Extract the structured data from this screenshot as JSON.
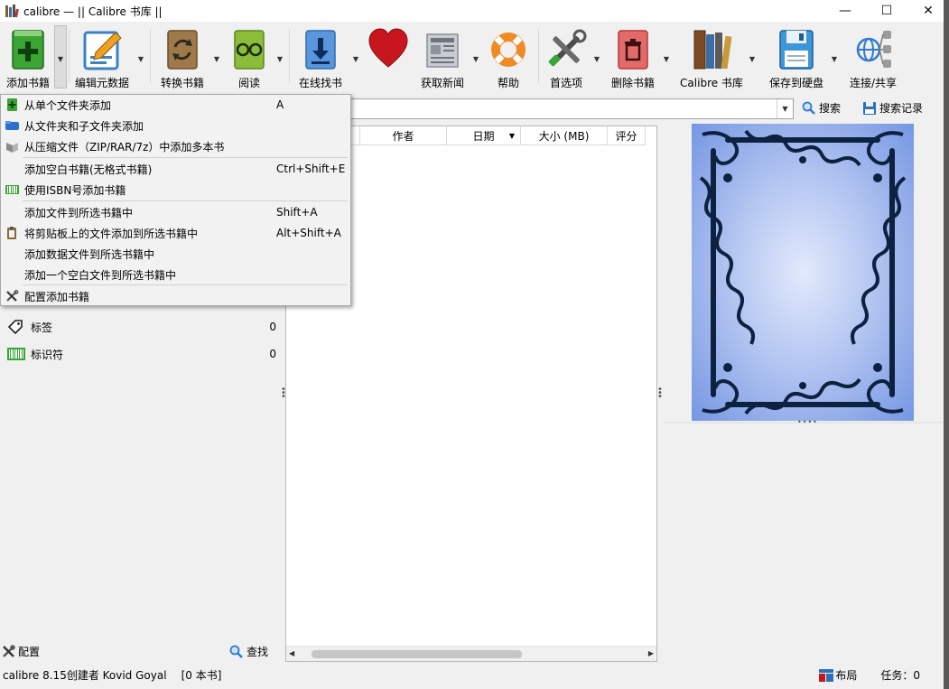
{
  "window": {
    "title": "calibre — || Calibre 书库 ||",
    "minimize_glyph": "—",
    "maximize_glyph": "☐",
    "close_glyph": "✕"
  },
  "toolbar": {
    "buttons": [
      {
        "label": "添加书籍",
        "icon": "add-book-icon"
      },
      {
        "label": "编辑元数据",
        "icon": "edit-metadata-icon"
      },
      {
        "label": "转换书籍",
        "icon": "convert-book-icon"
      },
      {
        "label": "阅读",
        "icon": "read-book-icon"
      },
      {
        "label": "在线找书",
        "icon": "find-books-online-icon"
      },
      {
        "label": "",
        "icon": "heart-icon"
      },
      {
        "label": "获取新闻",
        "icon": "news-icon"
      },
      {
        "label": "帮助",
        "icon": "help-lifebuoy-icon"
      },
      {
        "label": "首选项",
        "icon": "preferences-tools-icon"
      },
      {
        "label": "删除书籍",
        "icon": "remove-book-icon"
      },
      {
        "label": "Calibre 书库",
        "icon": "library-books-icon"
      },
      {
        "label": "保存到硬盘",
        "icon": "save-disk-icon"
      },
      {
        "label": "连接/共享",
        "icon": "connect-share-icon"
      }
    ]
  },
  "search": {
    "value": "",
    "search_label": "搜索",
    "history_label": "搜索记录"
  },
  "tag_browser": {
    "items": [
      {
        "label": "标签",
        "count": "0",
        "icon": "tag-icon"
      },
      {
        "label": "标识符",
        "count": "0",
        "icon": "barcode-icon"
      }
    ],
    "configure_label": "配置",
    "find_label": "查找"
  },
  "book_list": {
    "columns": [
      "作者",
      "日期",
      "大小 (MB)",
      "评分"
    ]
  },
  "add_menu": {
    "items": [
      {
        "label": "从单个文件夹添加",
        "shortcut": "A",
        "icon": "add-green-icon"
      },
      {
        "label": "从文件夹和子文件夹添加",
        "shortcut": "",
        "icon": "folder-blue-icon"
      },
      {
        "label": "从压缩文件（ZIP/RAR/7z）中添加多本书",
        "shortcut": "",
        "icon": "archive-book-icon"
      },
      {
        "label": "添加空白书籍(无格式书籍)",
        "shortcut": "Ctrl+Shift+E",
        "icon": ""
      },
      {
        "label": "使用ISBN号添加书籍",
        "shortcut": "",
        "icon": "barcode-icon"
      },
      {
        "label": "添加文件到所选书籍中",
        "shortcut": "Shift+A",
        "icon": ""
      },
      {
        "label": "将剪贴板上的文件添加到所选书籍中",
        "shortcut": "Alt+Shift+A",
        "icon": "clipboard-icon"
      },
      {
        "label": "添加数据文件到所选书籍中",
        "shortcut": "",
        "icon": ""
      },
      {
        "label": "添加一个空白文件到所选书籍中",
        "shortcut": "",
        "icon": ""
      },
      {
        "label": "配置添加书籍",
        "shortcut": "",
        "icon": "tools-icon"
      }
    ]
  },
  "status": {
    "left": "calibre 8.15创建者 Kovid Goyal",
    "book_count": "[0 本书]",
    "layout_label": "布局",
    "jobs": "任务：0"
  },
  "colors": {
    "accent_green": "#3aa535",
    "accent_blue": "#2f7ad0",
    "cover_frame": "#0d2140",
    "cover_bg": "#8aa6e8"
  }
}
